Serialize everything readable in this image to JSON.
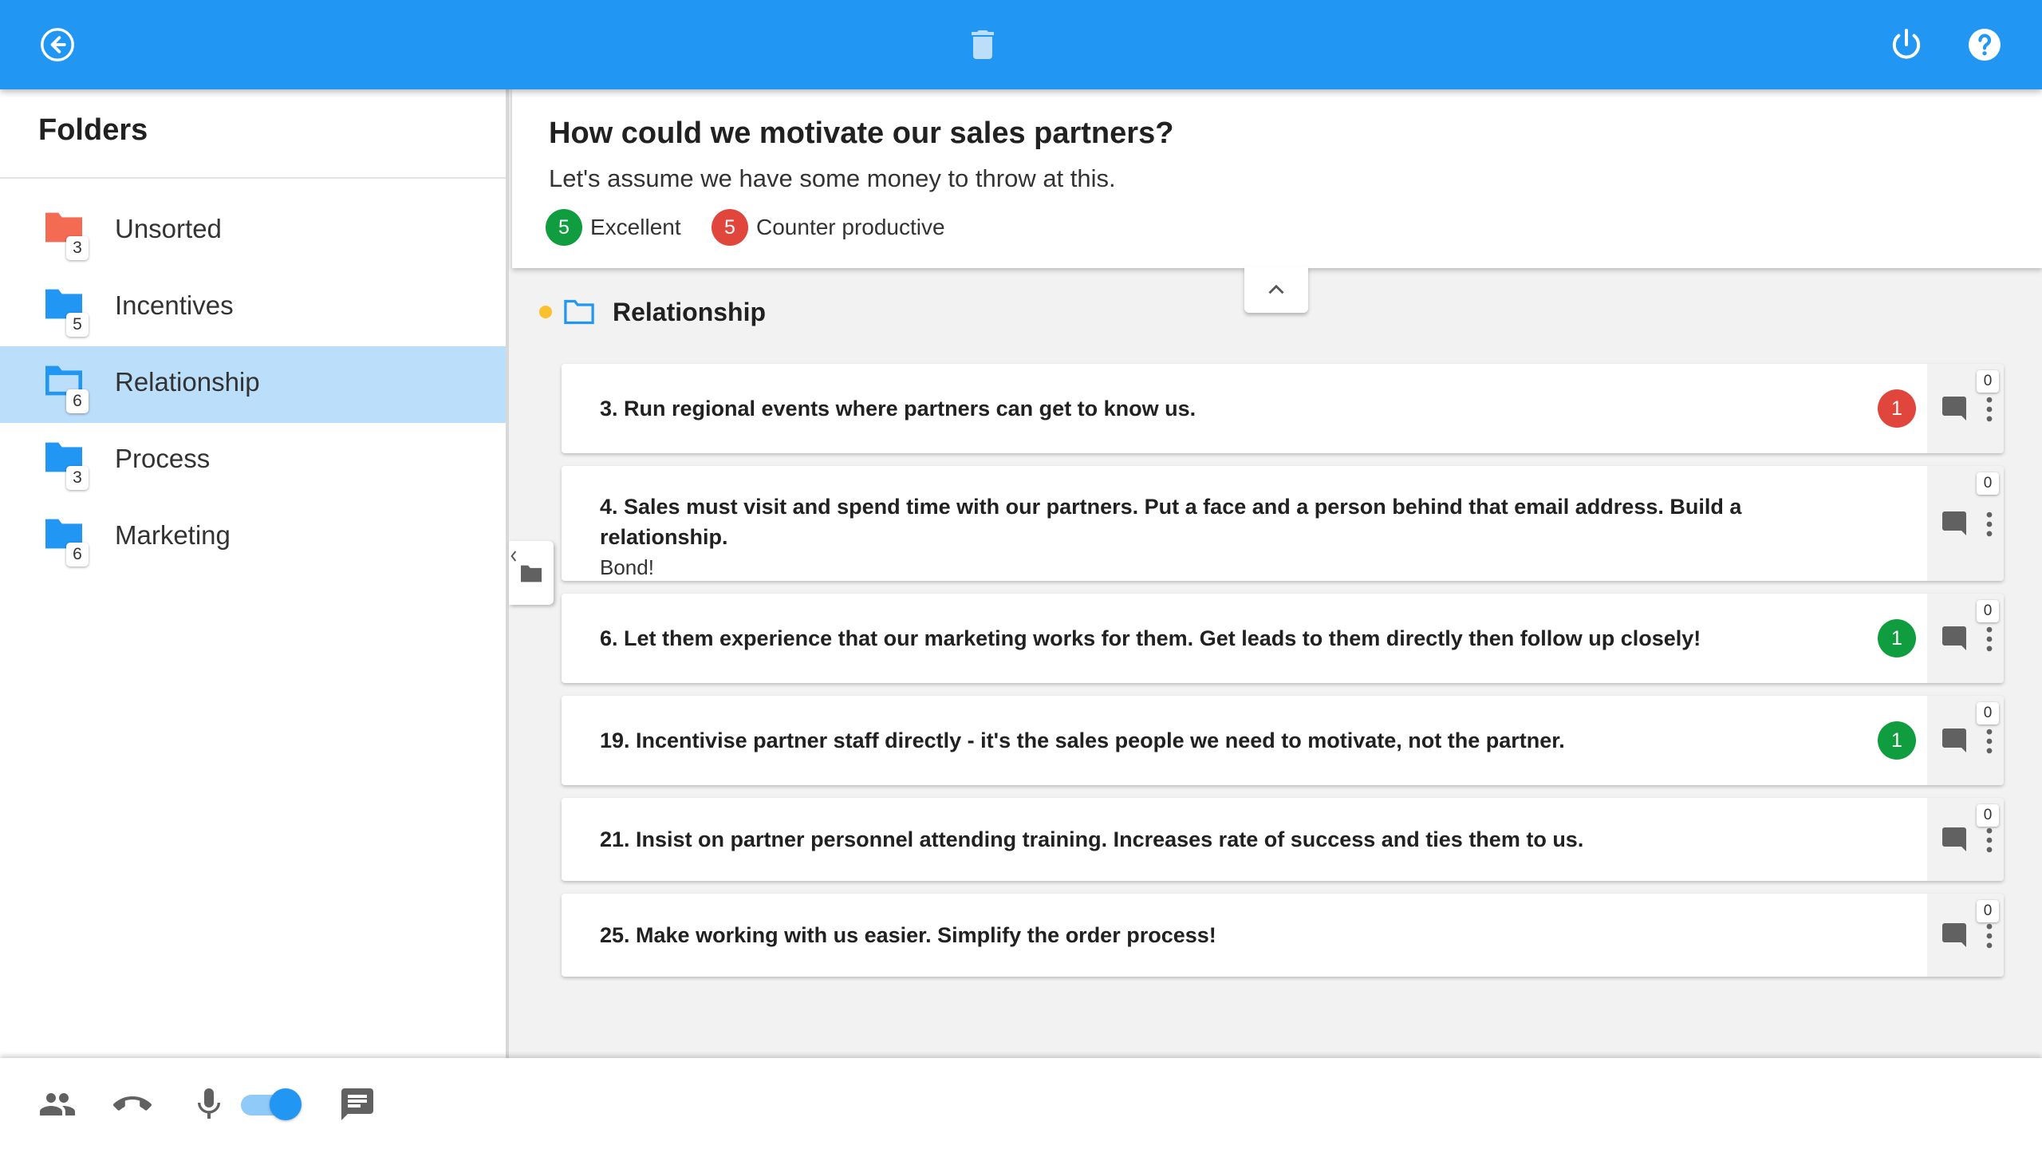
{
  "colors": {
    "primary": "#2196f3",
    "selected_row": "#bbdefb",
    "positive": "#0f9d3f",
    "negative": "#e0463c",
    "unsorted_folder": "#f26b52",
    "group_dot": "#fbc02d"
  },
  "toolbar": {
    "back_icon": "arrow-left-circle-icon",
    "delete_icon": "trash-icon",
    "power_icon": "power-icon",
    "help_icon": "help-circle-icon"
  },
  "sidebar": {
    "title": "Folders",
    "items": [
      {
        "label": "Unsorted",
        "count": "3",
        "icon": "folder-icon",
        "color": "#f26b52",
        "active": false
      },
      {
        "label": "Incentives",
        "count": "5",
        "icon": "folder-icon",
        "color": "#2196f3",
        "active": false
      },
      {
        "label": "Relationship",
        "count": "6",
        "icon": "folder-open-icon",
        "color": "#2196f3",
        "active": true
      },
      {
        "label": "Process",
        "count": "3",
        "icon": "folder-icon",
        "color": "#2196f3",
        "active": false
      },
      {
        "label": "Marketing",
        "count": "6",
        "icon": "folder-icon",
        "color": "#2196f3",
        "active": false
      }
    ]
  },
  "header": {
    "question": "How could we motivate our sales partners?",
    "description": "Let's assume we have some money to throw at this.",
    "legend": [
      {
        "count": "5",
        "label": "Excellent",
        "color": "#0f9d3f"
      },
      {
        "count": "5",
        "label": "Counter productive",
        "color": "#e0463c"
      }
    ]
  },
  "group": {
    "title": "Relationship"
  },
  "ideas": [
    {
      "text": "3. Run regional events where partners can get to know us.",
      "sub": "",
      "vote": "1",
      "vote_type": "negative",
      "comments": "0"
    },
    {
      "text": "4. Sales must visit and spend time with our partners. Put a face and a person behind that email address. Build a relationship.",
      "sub": "Bond!",
      "vote": "",
      "vote_type": "",
      "comments": "0"
    },
    {
      "text": "6. Let them experience that our marketing works for them. Get leads to them directly then follow up closely!",
      "sub": "",
      "vote": "1",
      "vote_type": "positive",
      "comments": "0"
    },
    {
      "text": "19. Incentivise partner staff directly - it's the sales people we need to motivate, not the partner.",
      "sub": "",
      "vote": "1",
      "vote_type": "positive",
      "comments": "0"
    },
    {
      "text": "21. Insist on partner personnel attending training. Increases rate of success and ties them to us.",
      "sub": "",
      "vote": "",
      "vote_type": "",
      "comments": "0"
    },
    {
      "text": "25. Make working with us easier. Simplify the order process!",
      "sub": "",
      "vote": "",
      "vote_type": "",
      "comments": "0"
    }
  ],
  "bottombar": {
    "participants_icon": "people-icon",
    "call_icon": "phone-hangup-icon",
    "mic_icon": "microphone-icon",
    "mic_enabled": true,
    "chat_icon": "chat-icon"
  }
}
